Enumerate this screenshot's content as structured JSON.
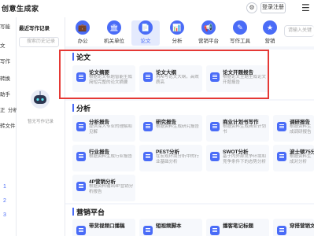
{
  "app": {
    "title": "创意生成家",
    "login_label": "登录注册",
    "settings_glyph": "⚙",
    "menu_glyph": "☰"
  },
  "left_nav": {
    "items": [
      "写能",
      "文",
      "写作",
      "转换",
      "助手",
      "正",
      "分析",
      "转文件"
    ],
    "footer": [
      "1",
      "2",
      "3"
    ]
  },
  "history": {
    "title": "最近写作记录",
    "search_placeholder": "搜索历史记录",
    "empty_text": "暂无写作记录"
  },
  "categories": [
    {
      "label": "办公",
      "icon": "💼",
      "name": "cat-office"
    },
    {
      "label": "机关单位",
      "icon": "🏛",
      "name": "cat-institution"
    },
    {
      "label": "论文",
      "icon": "📄",
      "name": "cat-thesis",
      "active": true
    },
    {
      "label": "分析",
      "icon": "📊",
      "name": "cat-analysis"
    },
    {
      "label": "营销平台",
      "icon": "📢",
      "name": "cat-marketing"
    },
    {
      "label": "写作工具",
      "icon": "✎",
      "name": "cat-writing-tools"
    },
    {
      "label": "营销",
      "icon": "★",
      "name": "cat-promo"
    }
  ],
  "search": {
    "placeholder": "请输入关键"
  },
  "sections": {
    "thesis": {
      "title": "论文",
      "cards": [
        {
          "title": "论文摘要",
          "desc": "根据论文标题智能生成简短完整的论文摘要"
        },
        {
          "title": "论文大纲",
          "desc": "用AI写论文大纲，高效质高"
        },
        {
          "title": "论文开题报告",
          "desc": "根据论文主题生成论文开题报告"
        }
      ]
    },
    "analysis": {
      "title": "分析",
      "cards": [
        {
          "title": "分析报告",
          "desc": "提供深入专业的理解和见解"
        },
        {
          "title": "研究报告",
          "desc": "根据资料生成研究报告"
        },
        {
          "title": "商业计划书写作",
          "desc": "根据资料生成商业计划书"
        },
        {
          "title": "调研报告",
          "desc": "根据资料生成调研报告"
        },
        {
          "title": "行业报告",
          "desc": "根据资料生成行业报告"
        },
        {
          "title": "PEST分析",
          "desc": "在宏观环境分析中的行业基础分析"
        },
        {
          "title": "SWOT分析",
          "desc": "基于内外部竞争环境和竞争条件下的态势分析"
        },
        {
          "title": "波士顿75分析",
          "desc": "根据资料生成对分析"
        },
        {
          "title": "4P营销分析",
          "desc": "根据资料输出4P营销分析报告"
        }
      ]
    },
    "marketing": {
      "title": "营销平台",
      "cards": [
        {
          "title": "带货视频口播稿"
        },
        {
          "title": "短视频脚本"
        },
        {
          "title": "播客笔记标题"
        },
        {
          "title": "穿搭营销文案"
        }
      ]
    }
  }
}
